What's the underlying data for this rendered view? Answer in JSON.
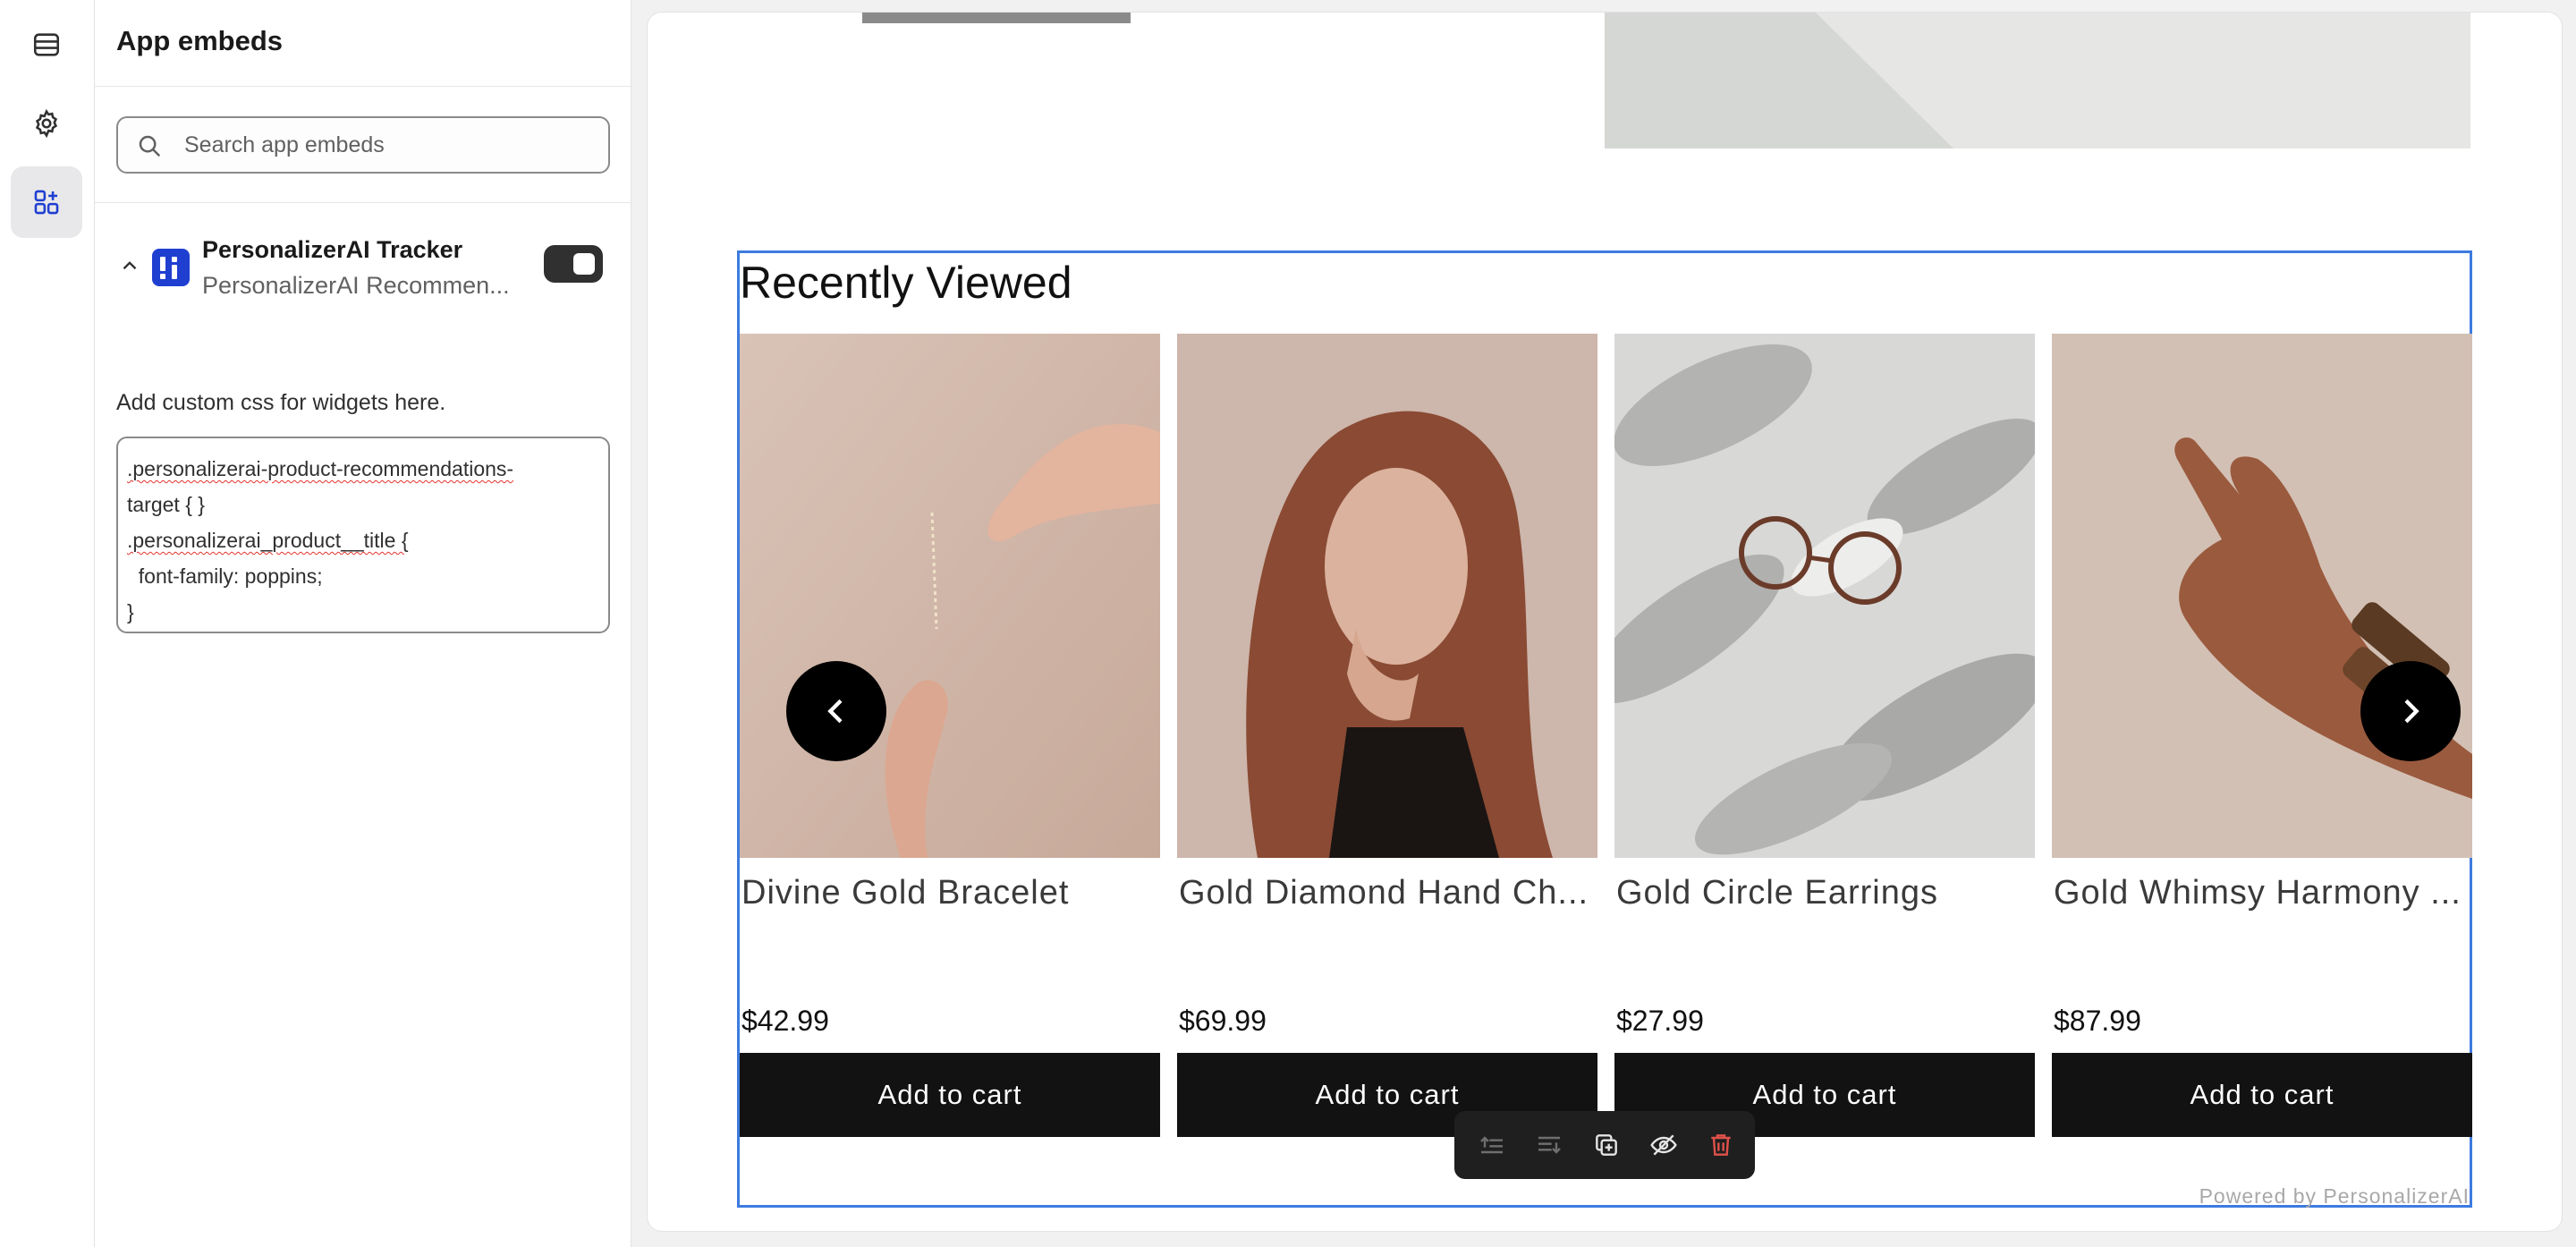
{
  "sidebar": {
    "title": "App embeds",
    "search_placeholder": "Search app embeds",
    "embed": {
      "name": "PersonalizerAI Tracker",
      "subtitle": "PersonalizerAI Recommen...",
      "enabled": true
    },
    "css_label": "Add custom css for widgets here.",
    "css_lines": [
      ".personalizerai-product-recommendations-",
      "target { }",
      ".personalizerai_product__title {",
      "  font-family: poppins;",
      "}"
    ]
  },
  "rail": {
    "icons": [
      "sections-icon",
      "settings-gear-icon",
      "app-embeds-icon"
    ],
    "active": "app-embeds-icon"
  },
  "preview": {
    "section_title": "Recently Viewed",
    "products": [
      {
        "name": "Divine Gold Bracelet",
        "price": "$42.99",
        "cta": "Add to cart"
      },
      {
        "name": "Gold Diamond Hand Ch...",
        "price": "$69.99",
        "cta": "Add to cart"
      },
      {
        "name": "Gold Circle Earrings",
        "price": "$27.99",
        "cta": "Add to cart"
      },
      {
        "name": "Gold Whimsy Harmony ...",
        "price": "$87.99",
        "cta": "Add to cart"
      }
    ],
    "powered_by": "Powered by PersonalizerAI"
  },
  "toolbar": {
    "icons": [
      "move-up-icon",
      "move-down-icon",
      "duplicate-icon",
      "hide-icon",
      "delete-icon"
    ]
  },
  "colors": {
    "accent": "#3d7be0",
    "button_bg": "#121212",
    "delete": "#e0514a",
    "brand_logo": "#1f3fd1"
  }
}
